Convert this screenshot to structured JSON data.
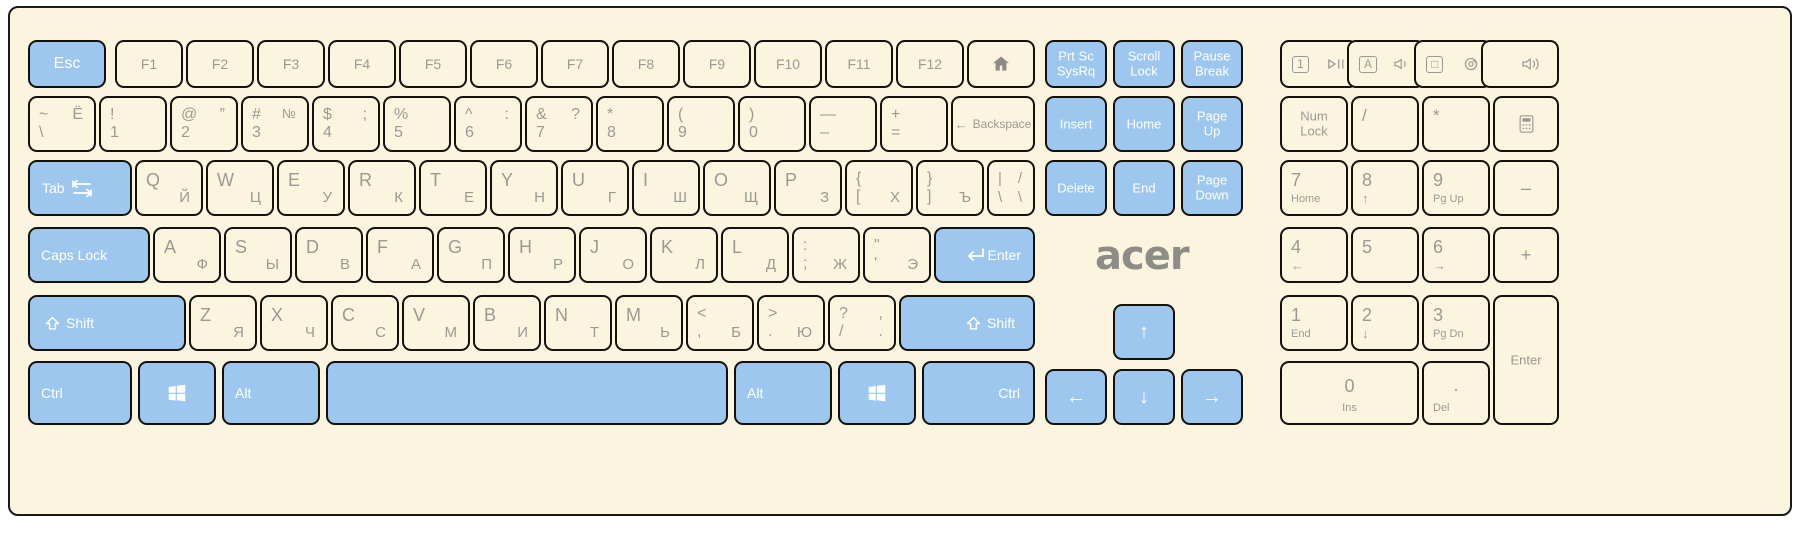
{
  "device": {
    "brand": "acer",
    "layout": "Russian / English (ЙЦУКЕН) full-size wireless keyboard",
    "colors": {
      "case": "#fbf5e0",
      "key_face": "#fbf5e0",
      "key_border": "#14110d",
      "accent_blue": "#9dc7ee",
      "legend_grey": "#9b9a92",
      "accent_text": "#ffffff"
    }
  },
  "rows": {
    "function_row": [
      {
        "name": "esc",
        "main": "Esc",
        "blue": true
      },
      {
        "name": "f1",
        "main": "F1"
      },
      {
        "name": "f2",
        "main": "F2"
      },
      {
        "name": "f3",
        "main": "F3"
      },
      {
        "name": "f4",
        "main": "F4"
      },
      {
        "name": "f5",
        "main": "F5"
      },
      {
        "name": "f6",
        "main": "F6"
      },
      {
        "name": "f7",
        "main": "F7"
      },
      {
        "name": "f8",
        "main": "F8"
      },
      {
        "name": "f9",
        "main": "F9"
      },
      {
        "name": "f10",
        "main": "F10"
      },
      {
        "name": "f11",
        "main": "F11"
      },
      {
        "name": "f12",
        "main": "F12"
      },
      {
        "name": "home-shortcut",
        "icon": "home-icon"
      }
    ],
    "number_row": [
      {
        "name": "backquote",
        "tl": "~",
        "tr": "Ё",
        "bl": "\\"
      },
      {
        "name": "digit-1",
        "tl": "!",
        "bl": "1"
      },
      {
        "name": "digit-2",
        "tl": "@",
        "tr": "”",
        "bl": "2"
      },
      {
        "name": "digit-3",
        "tl": "#",
        "tr": "№",
        "bl": "3"
      },
      {
        "name": "digit-4",
        "tl": "$",
        "tr": ";",
        "bl": "4"
      },
      {
        "name": "digit-5",
        "tl": "%",
        "bl": "5"
      },
      {
        "name": "digit-6",
        "tl": "^",
        "tr": ":",
        "bl": "6"
      },
      {
        "name": "digit-7",
        "tl": "&",
        "tr": "?",
        "bl": "7"
      },
      {
        "name": "digit-8",
        "tl": "*",
        "bl": "8"
      },
      {
        "name": "digit-9",
        "tl": "(",
        "bl": "9"
      },
      {
        "name": "digit-0",
        "tl": ")",
        "bl": "0"
      },
      {
        "name": "minus",
        "tl": "—",
        "bl": "–"
      },
      {
        "name": "equal",
        "tl": "+",
        "bl": "="
      },
      {
        "name": "backspace",
        "main": "Backspace",
        "arrow": "←"
      }
    ],
    "top_letter_row": [
      {
        "name": "tab",
        "main": "Tab",
        "blue": true,
        "icon": "tab-arrows-icon"
      },
      {
        "name": "key-q",
        "tl": "Q",
        "br": "Й"
      },
      {
        "name": "key-w",
        "tl": "W",
        "br": "Ц"
      },
      {
        "name": "key-e",
        "tl": "E",
        "br": "У"
      },
      {
        "name": "key-r",
        "tl": "R",
        "br": "К"
      },
      {
        "name": "key-t",
        "tl": "T",
        "br": "Е"
      },
      {
        "name": "key-y",
        "tl": "Y",
        "br": "Н"
      },
      {
        "name": "key-u",
        "tl": "U",
        "br": "Г"
      },
      {
        "name": "key-i",
        "tl": "I",
        "br": "Ш"
      },
      {
        "name": "key-o",
        "tl": "O",
        "br": "Щ"
      },
      {
        "name": "key-p",
        "tl": "P",
        "br": "З"
      },
      {
        "name": "bracket-left",
        "tl": "{",
        "bl": "[",
        "br": "Х"
      },
      {
        "name": "bracket-right",
        "tl": "}",
        "bl": "]",
        "br": "Ъ"
      },
      {
        "name": "backslash",
        "tl": "|",
        "tr": "/",
        "bl": "\\",
        "br": "\\"
      }
    ],
    "home_row": [
      {
        "name": "caps-lock",
        "main": "Caps Lock",
        "blue": true
      },
      {
        "name": "key-a",
        "tl": "A",
        "br": "Ф"
      },
      {
        "name": "key-s",
        "tl": "S",
        "br": "Ы"
      },
      {
        "name": "key-d",
        "tl": "D",
        "br": "В"
      },
      {
        "name": "key-f",
        "tl": "F",
        "br": "А"
      },
      {
        "name": "key-g",
        "tl": "G",
        "br": "П"
      },
      {
        "name": "key-h",
        "tl": "H",
        "br": "Р"
      },
      {
        "name": "key-j",
        "tl": "J",
        "br": "О"
      },
      {
        "name": "key-k",
        "tl": "K",
        "br": "Л"
      },
      {
        "name": "key-l",
        "tl": "L",
        "br": "Д"
      },
      {
        "name": "semicolon",
        "tl": ":",
        "bl": ";",
        "br": "Ж"
      },
      {
        "name": "quote",
        "tl": "\"",
        "bl": "'",
        "br": "Э"
      },
      {
        "name": "enter",
        "main": "Enter",
        "blue": true,
        "icon": "enter-arrow-icon"
      }
    ],
    "shift_row": [
      {
        "name": "shift-left",
        "main": "Shift",
        "blue": true,
        "icon": "shift-up-icon"
      },
      {
        "name": "key-z",
        "tl": "Z",
        "br": "Я"
      },
      {
        "name": "key-x",
        "tl": "X",
        "br": "Ч"
      },
      {
        "name": "key-c",
        "tl": "C",
        "br": "С"
      },
      {
        "name": "key-v",
        "tl": "V",
        "br": "М"
      },
      {
        "name": "key-b",
        "tl": "B",
        "br": "И"
      },
      {
        "name": "key-n",
        "tl": "N",
        "br": "Т"
      },
      {
        "name": "key-m",
        "tl": "M",
        "br": "Ь"
      },
      {
        "name": "comma",
        "tl": "<",
        "bl": ",",
        "br": "Б"
      },
      {
        "name": "period",
        "tl": ">",
        "bl": ".",
        "br": "Ю"
      },
      {
        "name": "slash",
        "tl": "?",
        "tr": ",",
        "bl": "/",
        "br": "."
      },
      {
        "name": "shift-right",
        "main": "Shift",
        "blue": true,
        "icon": "shift-up-icon"
      }
    ],
    "bottom_row": [
      {
        "name": "ctrl-left",
        "main": "Ctrl",
        "blue": true
      },
      {
        "name": "win-left",
        "icon": "windows-icon",
        "blue": true
      },
      {
        "name": "alt-left",
        "main": "Alt",
        "blue": true
      },
      {
        "name": "space",
        "main": "",
        "blue": true
      },
      {
        "name": "alt-right",
        "main": "Alt",
        "blue": true
      },
      {
        "name": "win-right",
        "icon": "windows-icon",
        "blue": true
      },
      {
        "name": "ctrl-right",
        "main": "Ctrl",
        "blue": true
      }
    ]
  },
  "nav_cluster": {
    "row1": [
      {
        "name": "print-screen",
        "line1": "Prt Sc",
        "line2": "SysRq",
        "blue": true
      },
      {
        "name": "scroll-lock",
        "line1": "Scroll",
        "line2": "Lock",
        "blue": true
      },
      {
        "name": "pause-break",
        "line1": "Pause",
        "line2": "Break",
        "blue": true
      }
    ],
    "row2": [
      {
        "name": "insert",
        "line1": "Insert",
        "blue": true
      },
      {
        "name": "home",
        "line1": "Home",
        "blue": true
      },
      {
        "name": "page-up",
        "line1": "Page",
        "line2": "Up",
        "blue": true
      }
    ],
    "row3": [
      {
        "name": "delete",
        "line1": "Delete",
        "blue": true
      },
      {
        "name": "end",
        "line1": "End",
        "blue": true
      },
      {
        "name": "page-down",
        "line1": "Page",
        "line2": "Down",
        "blue": true
      }
    ],
    "arrows": [
      {
        "name": "arrow-up",
        "glyph": "↑",
        "blue": true
      },
      {
        "name": "arrow-left",
        "glyph": "←",
        "blue": true
      },
      {
        "name": "arrow-down",
        "glyph": "↓",
        "blue": true
      },
      {
        "name": "arrow-right",
        "glyph": "→",
        "blue": true
      }
    ]
  },
  "media_row": [
    {
      "name": "media-play-pause",
      "box": "1",
      "glyph": "play-pause-icon"
    },
    {
      "name": "media-mute-toggle",
      "box": "A",
      "glyph": "speaker-small-icon"
    },
    {
      "name": "media-app-launch",
      "box": "□",
      "glyph": "at-circle-icon"
    },
    {
      "name": "media-volume",
      "box": "",
      "glyph": "speaker-wave-icon"
    }
  ],
  "numpad": {
    "row1": [
      {
        "name": "num-lock",
        "line1": "Num",
        "line2": "Lock"
      },
      {
        "name": "numpad-divide",
        "main": "/"
      },
      {
        "name": "numpad-multiply",
        "main": "*"
      },
      {
        "name": "calculator",
        "icon": "calculator-icon"
      }
    ],
    "row2": [
      {
        "name": "numpad-7",
        "num": "7",
        "sub": "Home"
      },
      {
        "name": "numpad-8",
        "num": "8",
        "sub": "↑"
      },
      {
        "name": "numpad-9",
        "num": "9",
        "sub": "Pg Up"
      },
      {
        "name": "numpad-subtract",
        "main": "–"
      }
    ],
    "row3": [
      {
        "name": "numpad-4",
        "num": "4",
        "sub": "←"
      },
      {
        "name": "numpad-5",
        "num": "5",
        "sub": ""
      },
      {
        "name": "numpad-6",
        "num": "6",
        "sub": "→"
      },
      {
        "name": "numpad-add",
        "main": "+"
      }
    ],
    "row4": [
      {
        "name": "numpad-1",
        "num": "1",
        "sub": "End"
      },
      {
        "name": "numpad-2",
        "num": "2",
        "sub": "↓"
      },
      {
        "name": "numpad-3",
        "num": "3",
        "sub": "Pg Dn"
      },
      {
        "name": "numpad-enter",
        "main": "Enter"
      }
    ],
    "row5": [
      {
        "name": "numpad-0",
        "num": "0",
        "sub": "Ins"
      },
      {
        "name": "numpad-decimal",
        "num": ".",
        "sub": "Del"
      }
    ]
  }
}
